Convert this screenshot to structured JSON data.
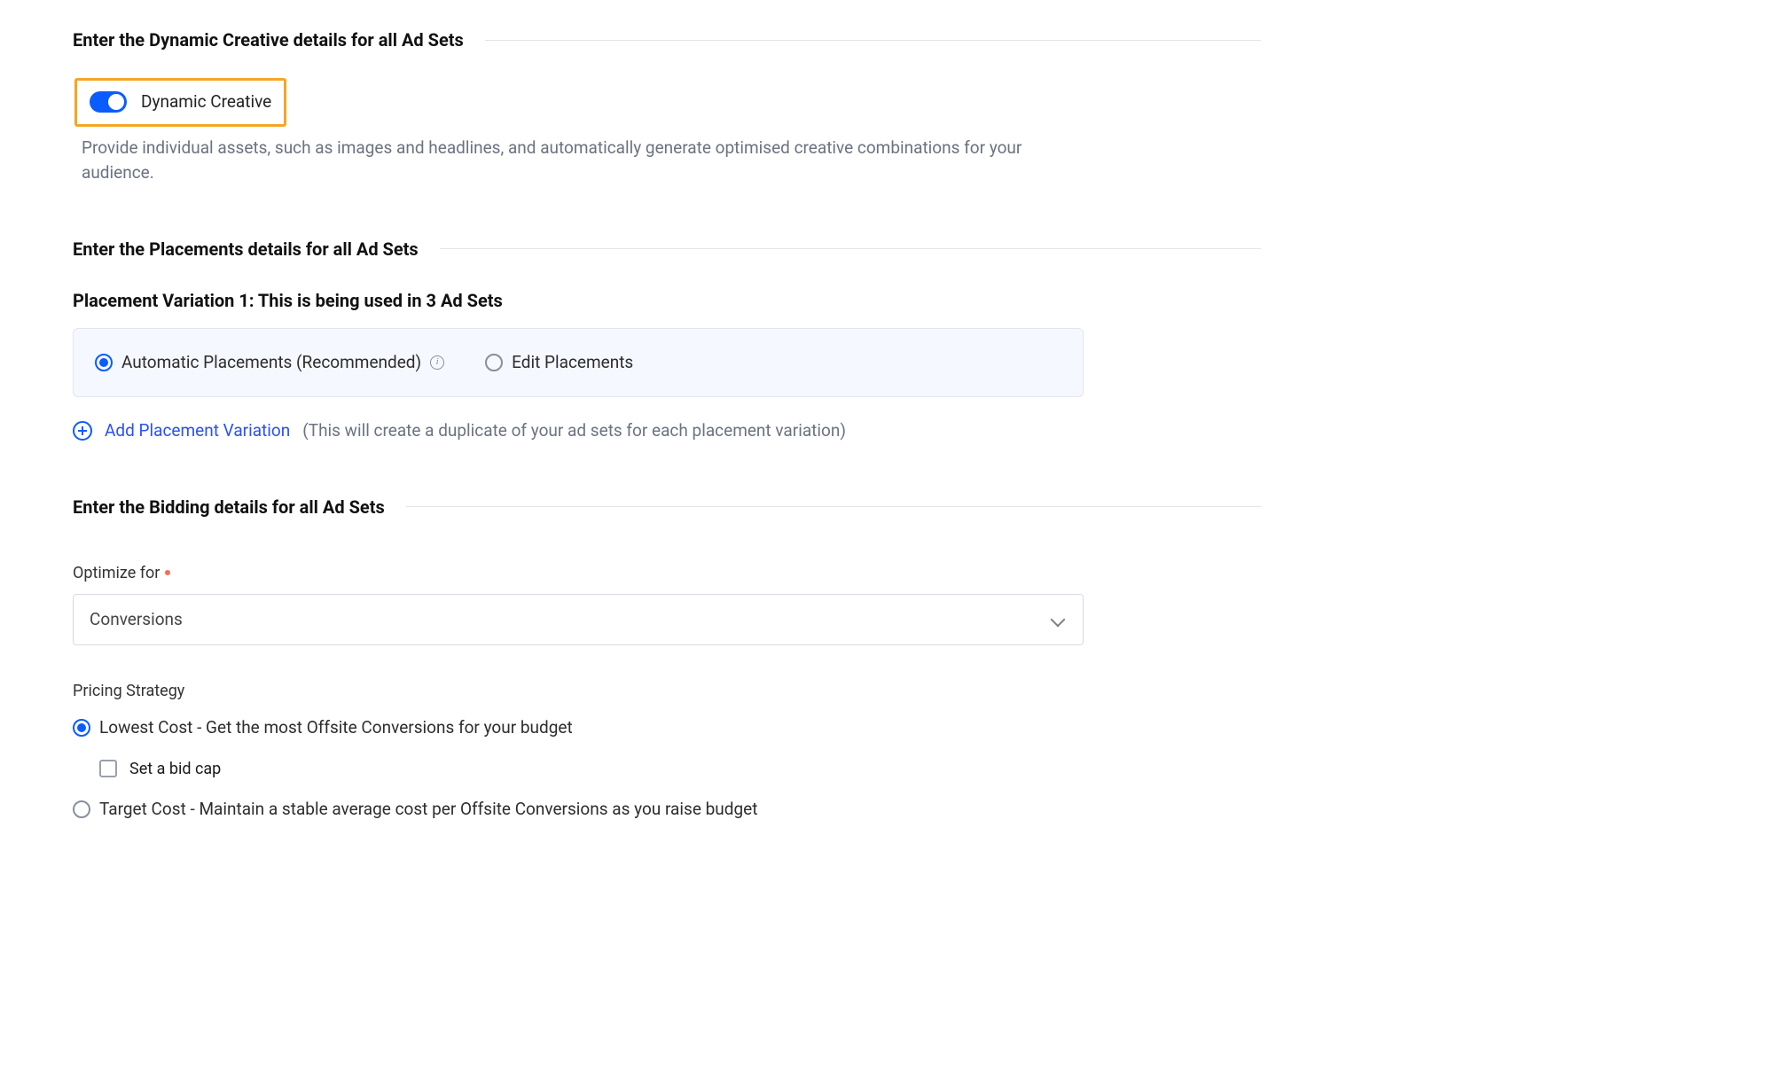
{
  "dynamic_creative": {
    "heading": "Enter the Dynamic Creative details for all Ad Sets",
    "toggle_label": "Dynamic Creative",
    "toggle_on": true,
    "description": "Provide individual assets, such as images and headlines, and automatically generate optimised creative combinations for your audience."
  },
  "placements": {
    "heading": "Enter the Placements details for all Ad Sets",
    "variation_heading": "Placement Variation 1: This is being used in 3 Ad Sets",
    "options": {
      "automatic": "Automatic Placements (Recommended)",
      "edit": "Edit Placements"
    },
    "add_link": "Add Placement Variation",
    "add_hint": "(This will create a duplicate of your ad sets for each placement variation)"
  },
  "bidding": {
    "heading": "Enter the Bidding details for all Ad Sets",
    "optimize_label": "Optimize for",
    "optimize_value": "Conversions",
    "pricing_label": "Pricing Strategy",
    "lowest_cost": "Lowest Cost - Get the most Offsite Conversions for your budget",
    "bid_cap": "Set a bid cap",
    "target_cost": "Target Cost - Maintain a stable average cost per Offsite Conversions as you raise budget"
  }
}
